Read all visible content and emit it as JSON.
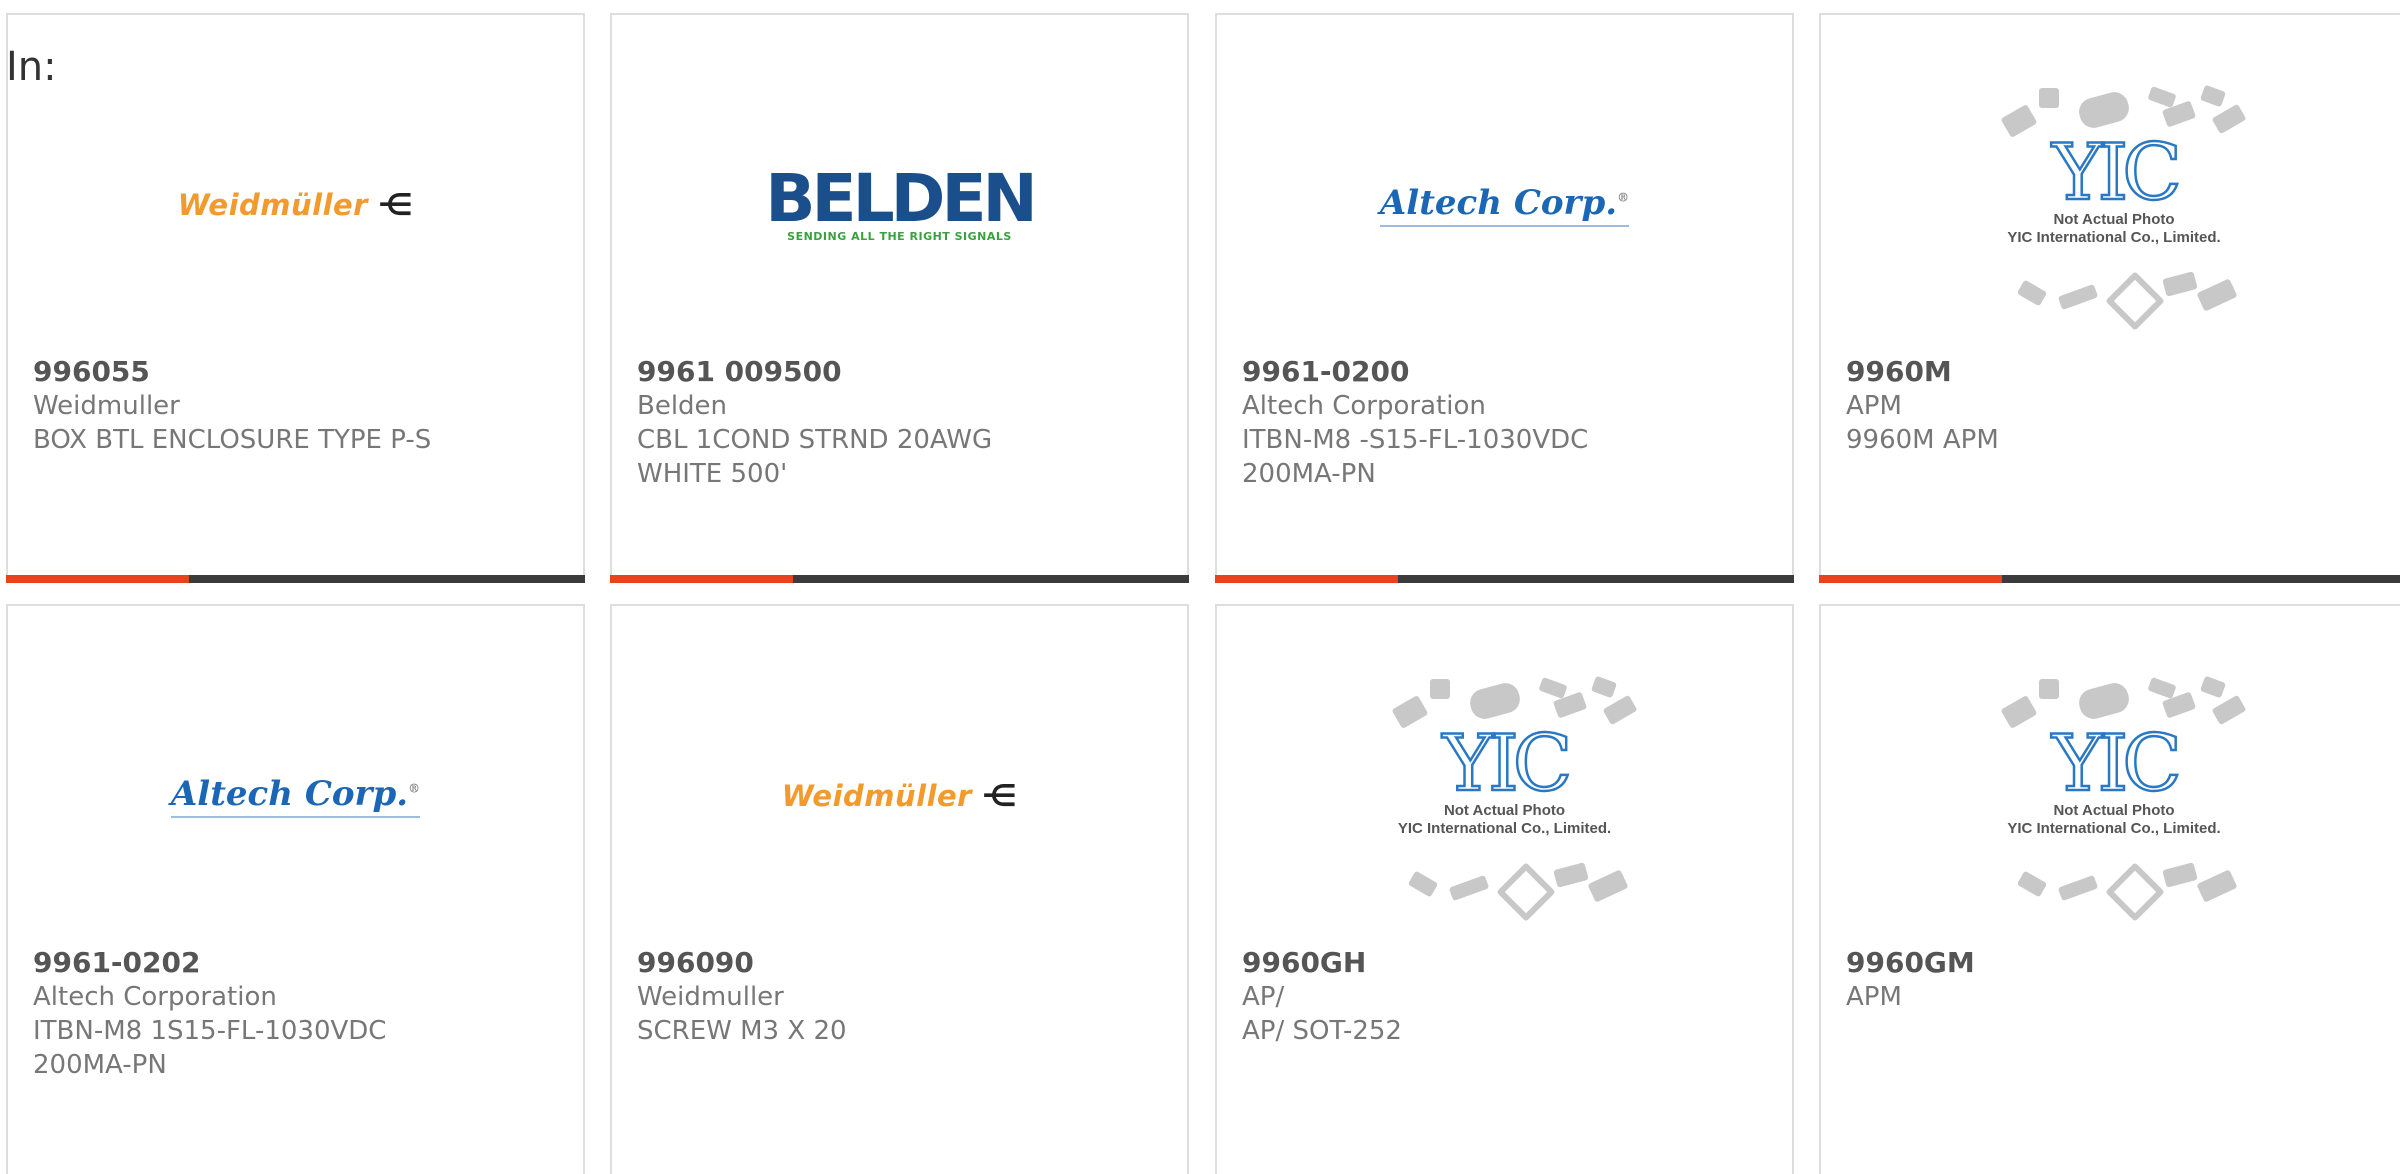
{
  "filter": {
    "label": "In:"
  },
  "cards": [
    {
      "part": "996055",
      "brand": "Weidmuller",
      "desc1": "BOX BTL ENCLOSURE TYPE P-S",
      "desc2": "",
      "logo": "weidmuller"
    },
    {
      "part": "9961 009500",
      "brand": "Belden",
      "desc1": "CBL 1COND STRND 20AWG",
      "desc2": "WHITE 500'",
      "logo": "belden"
    },
    {
      "part": "9961-0200",
      "brand": "Altech Corporation",
      "desc1": "ITBN-M8 -S15-FL-1030VDC",
      "desc2": "200MA-PN",
      "logo": "altech"
    },
    {
      "part": "9960M",
      "brand": "APM",
      "desc1": "9960M APM",
      "desc2": "",
      "logo": "yic"
    },
    {
      "part": "9961-0202",
      "brand": "Altech Corporation",
      "desc1": "ITBN-M8 1S15-FL-1030VDC",
      "desc2": "200MA-PN",
      "logo": "altech"
    },
    {
      "part": "996090",
      "brand": "Weidmuller",
      "desc1": "SCREW M3 X 20",
      "desc2": "",
      "logo": "weidmuller"
    },
    {
      "part": "9960GH",
      "brand": "AP/",
      "desc1": "AP/ SOT-252",
      "desc2": "",
      "logo": "yic"
    },
    {
      "part": "9960GM",
      "brand": "APM",
      "desc1": "",
      "desc2": "",
      "logo": "yic"
    }
  ],
  "logos": {
    "weidmuller": "Weidmüller",
    "weidmuller_mark": "⋲",
    "belden": "BELDEN",
    "belden_tag": "SENDING ALL THE RIGHT SIGNALS",
    "altech": "Altech Corp.",
    "altech_reg": "®",
    "yic_mark": "YIC",
    "yic_note1": "Not Actual Photo",
    "yic_note2": "YIC International Co., Limited."
  },
  "colors": {
    "accent": "#e8431b",
    "bar": "#3b3b3b",
    "altech_blue": "#1c67b5",
    "belden_blue": "#1b4f8c",
    "weidmuller_orange": "#f29a2e"
  }
}
